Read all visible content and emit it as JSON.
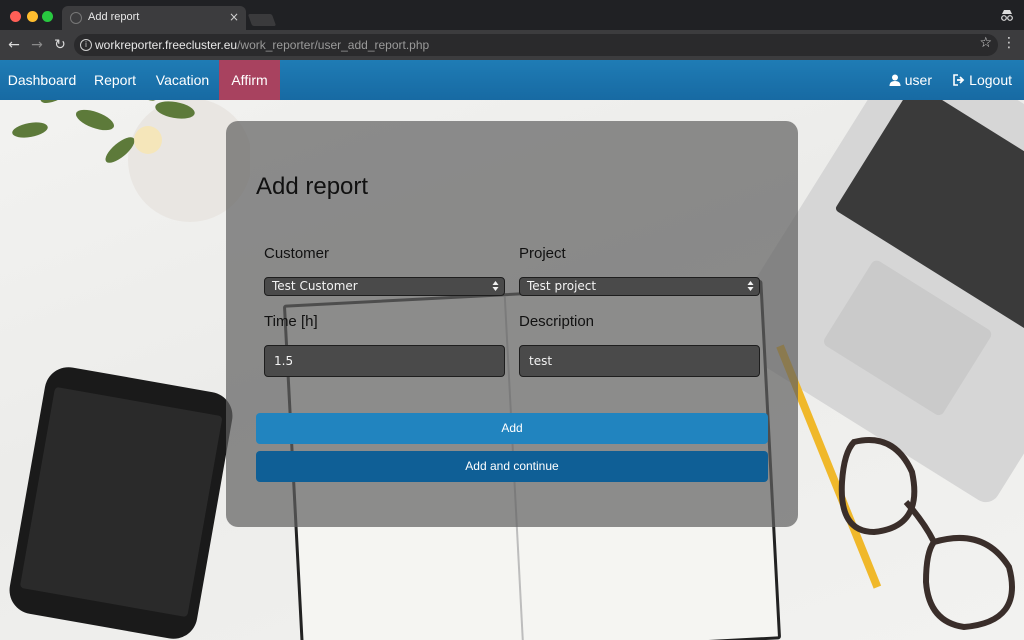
{
  "browser": {
    "tab_title": "Add report",
    "tab_close": "×",
    "url_host": "workreporter.freecluster.eu",
    "url_path": "/work_reporter/user_add_report.php"
  },
  "navbar": {
    "items": [
      {
        "label": "Dashboard"
      },
      {
        "label": "Report"
      },
      {
        "label": "Vacation"
      },
      {
        "label": "Affirm"
      }
    ],
    "active": "Affirm",
    "active_color": "#a8425f",
    "bar_color": "#1f7cb5",
    "user_label": "user",
    "logout_label": "Logout"
  },
  "form": {
    "title": "Add report",
    "customer": {
      "label": "Customer",
      "value": "Test Customer"
    },
    "project": {
      "label": "Project",
      "value": "Test project"
    },
    "time": {
      "label": "Time [h]",
      "value": "1.5"
    },
    "description": {
      "label": "Description",
      "value": "test"
    },
    "add_label": "Add",
    "add_continue_label": "Add and continue",
    "add_color": "#2184bf",
    "add_continue_color": "#0f5f96"
  }
}
